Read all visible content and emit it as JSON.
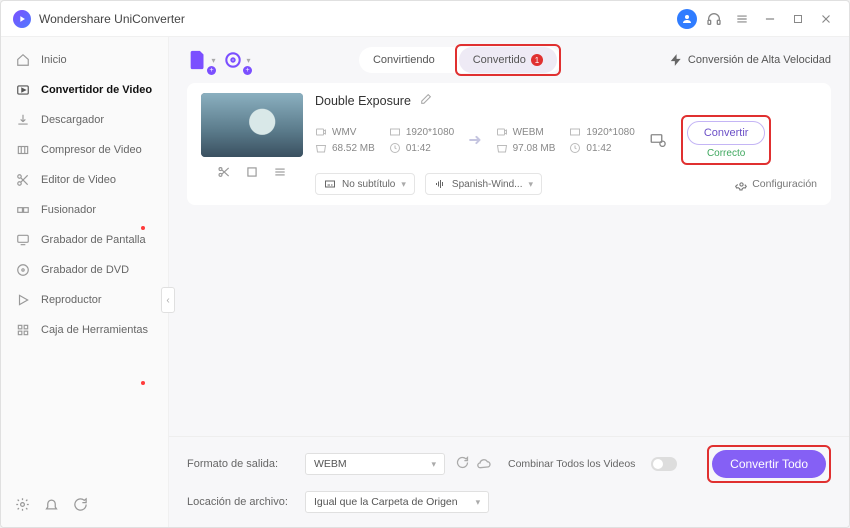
{
  "title": "Wondershare UniConverter",
  "sidebar": {
    "items": [
      {
        "label": "Inicio"
      },
      {
        "label": "Convertidor de Video"
      },
      {
        "label": "Descargador"
      },
      {
        "label": "Compresor de Video"
      },
      {
        "label": "Editor de Video"
      },
      {
        "label": "Fusionador"
      },
      {
        "label": "Grabador de Pantalla"
      },
      {
        "label": "Grabador de DVD"
      },
      {
        "label": "Reproductor"
      },
      {
        "label": "Caja de Herramientas"
      }
    ]
  },
  "tabs": {
    "converting": "Convirtiendo",
    "converted": "Convertido",
    "badge": "1"
  },
  "speed_label": "Conversión de Alta Velocidad",
  "file": {
    "name": "Double Exposure",
    "src_format": "WMV",
    "src_res": "1920*1080",
    "src_size": "68.52 MB",
    "src_dur": "01:42",
    "dst_format": "WEBM",
    "dst_res": "1920*1080",
    "dst_size": "97.08 MB",
    "dst_dur": "01:42",
    "convert_label": "Convertir",
    "status": "Correcto"
  },
  "subtitle_dd": "No subtítulo",
  "audio_dd": "Spanish-Wind...",
  "config_label": "Configuración",
  "bottom": {
    "format_label": "Formato de salida:",
    "format_value": "WEBM",
    "location_label": "Locación de archivo:",
    "location_value": "Igual que la Carpeta de Origen",
    "merge_label": "Combinar Todos los Videos",
    "convert_all": "Convertir Todo"
  }
}
